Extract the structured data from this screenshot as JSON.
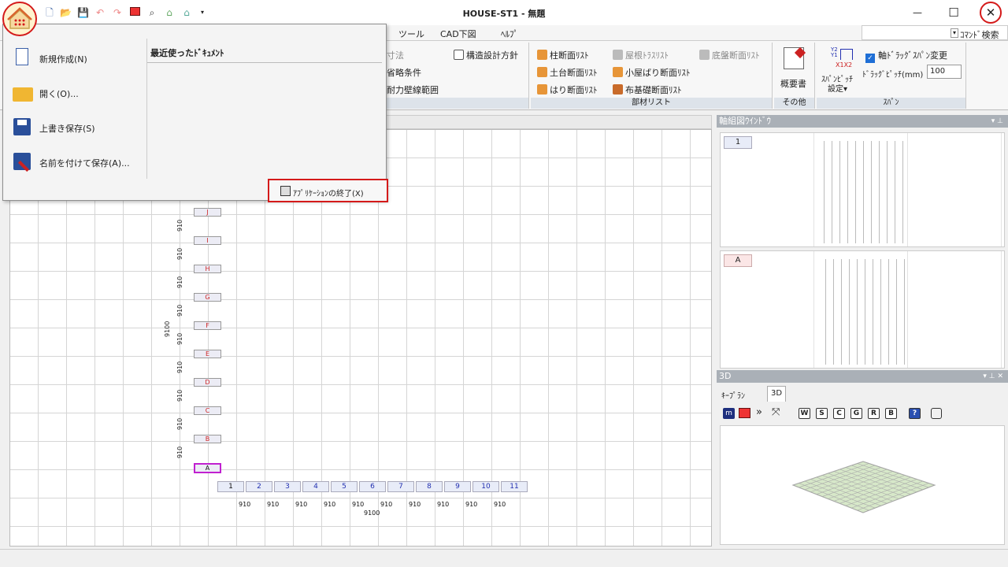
{
  "title": "HOUSE-ST1 - 無題",
  "window_controls": {
    "minimize": "—",
    "maximize": "☐",
    "close": "✕"
  },
  "tabs": [
    "ツール",
    "CAD下図",
    "ﾍﾙﾌﾟ"
  ],
  "command_search": "ｺﾏﾝﾄﾞ検索",
  "ribbon": {
    "partial": {
      "item1": "寸法",
      "item2": "省略条件",
      "item3": "耐力壁線範囲",
      "item4": "構造設計方針"
    },
    "buzai": {
      "label": "部材リスト",
      "items": [
        "柱断面ﾘｽﾄ",
        "屋根ﾄﾗｽﾘｽﾄ",
        "底盤断面ﾘｽﾄ",
        "土台断面ﾘｽﾄ",
        "小屋ばり断面ﾘｽﾄ",
        "はり断面ﾘｽﾄ",
        "布基礎断面ﾘｽﾄ"
      ]
    },
    "sonota": {
      "label": "その他",
      "button": "概要書"
    },
    "span": {
      "label": "ｽﾊﾟﾝ",
      "pitch_button_line1": "ｽﾊﾟﾝﾋﾟｯﾁ",
      "pitch_button_line2": "設定",
      "drag_change_label": "軸ﾄﾞﾗｯｸﾞｽﾊﾟﾝ変更",
      "drag_pitch_label": "ﾄﾞﾗｯｸﾞﾋﾟｯﾁ(mm)",
      "drag_pitch_value": "100",
      "icon_text_top": "Y2 Y1",
      "icon_text_bottom": "X1X2"
    }
  },
  "app_menu": {
    "items": [
      {
        "label": "新規作成(N)"
      },
      {
        "label": "開く(O)..."
      },
      {
        "label": "上書き保存(S)"
      },
      {
        "label": "名前を付けて保存(A)..."
      }
    ],
    "recent_header": "最近使ったﾄﾞｷｭﾒﾝﾄ",
    "exit_label": "ｱﾌﾟﾘｹｰｼｮﾝの終了(X)"
  },
  "grid": {
    "rows": [
      "J",
      "I",
      "H",
      "G",
      "F",
      "E",
      "D",
      "C",
      "B",
      "A"
    ],
    "cols": [
      "1",
      "2",
      "3",
      "4",
      "5",
      "6",
      "7",
      "8",
      "9",
      "10",
      "11"
    ],
    "dim": "910",
    "total": "9100"
  },
  "axis_window": {
    "title": "軸組図ｳｲﾝﾄﾞｳ",
    "tag1": "1",
    "tag2": "A"
  },
  "view3d": {
    "title": "3D",
    "tabs": [
      "ｷｰﾌﾟﾗﾝ",
      "3D"
    ],
    "toolbar": [
      "W",
      "S",
      "C",
      "G",
      "R",
      "B",
      "?"
    ]
  },
  "colors": {
    "accent_red": "#d41a1a",
    "col_blue": "#2230b0",
    "row_red": "#c22222"
  }
}
